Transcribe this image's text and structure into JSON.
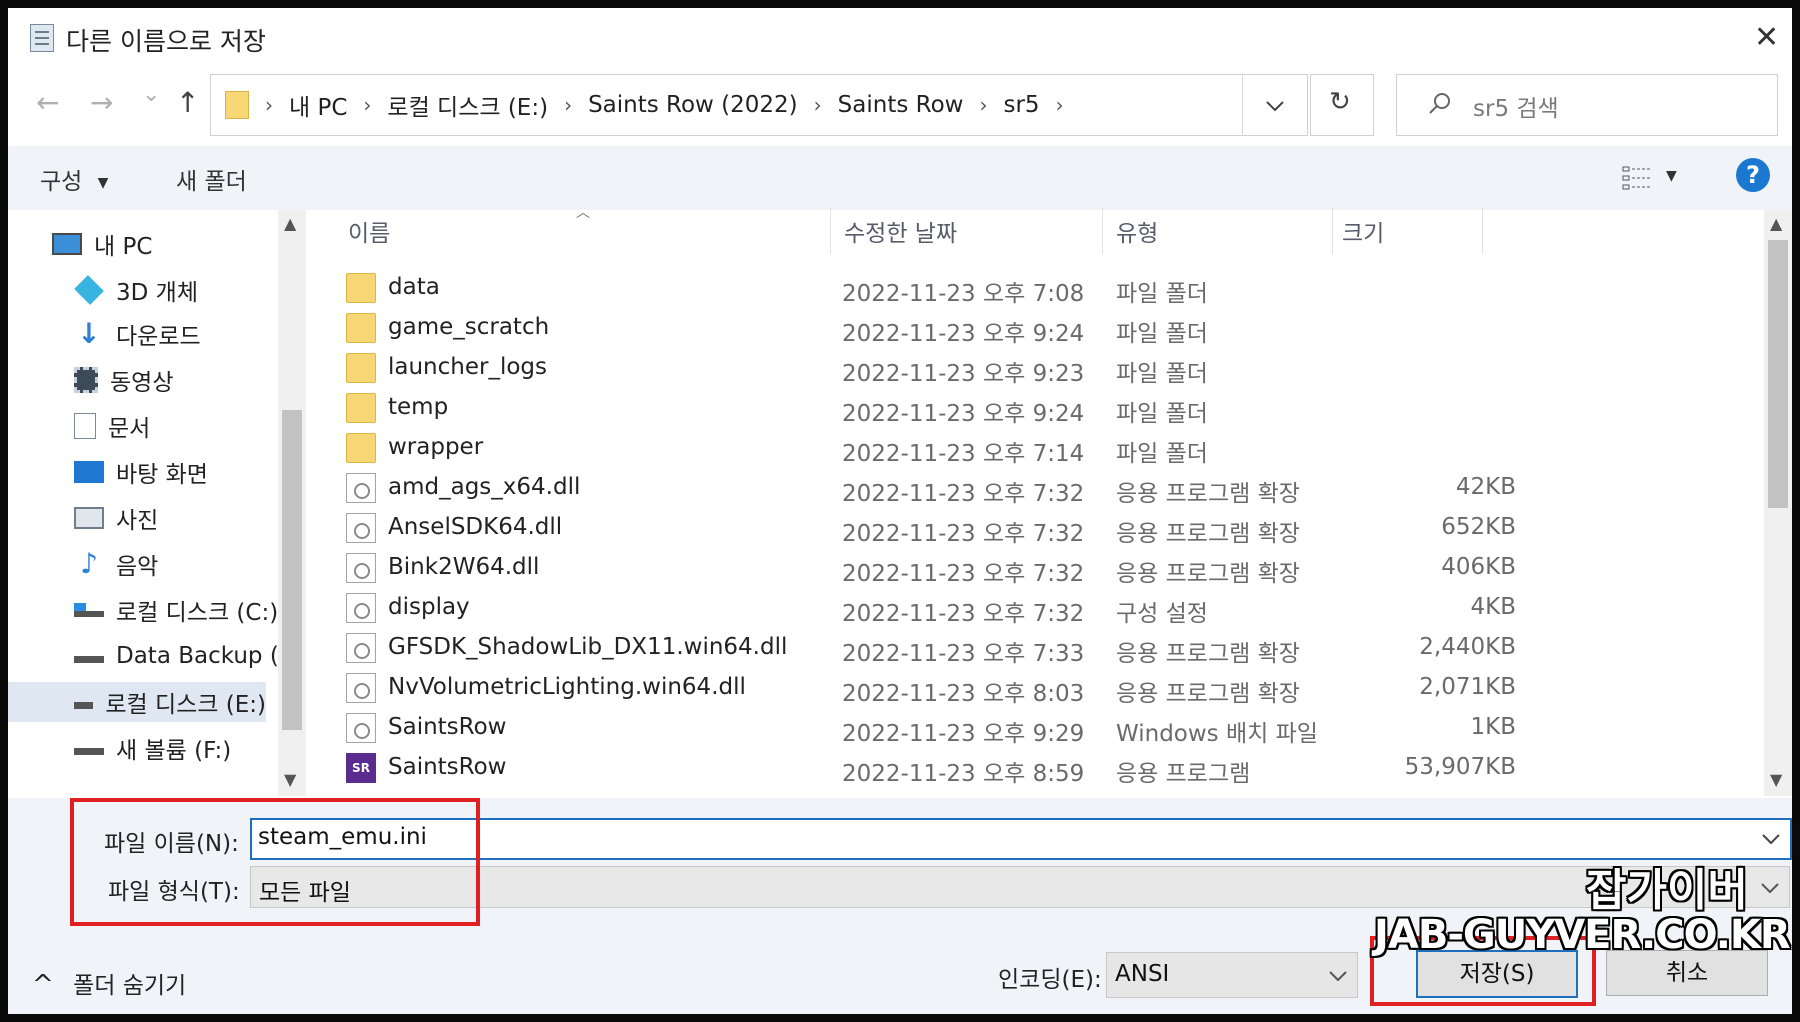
{
  "dialog": {
    "title": "다른 이름으로 저장",
    "close_glyph": "✕"
  },
  "nav": {
    "back_glyph": "←",
    "forward_glyph": "→",
    "recent_glyph": "⌄",
    "up_glyph": "↑",
    "breadcrumb": [
      "내 PC",
      "로컬 디스크 (E:)",
      "Saints Row (2022)",
      "Saints Row",
      "sr5"
    ],
    "breadcrumb_sep": "›",
    "refresh_glyph": "↻",
    "search_placeholder": "sr5 검색"
  },
  "toolbar": {
    "organize_label": "구성",
    "new_folder_label": "새 폴더",
    "help_glyph": "?"
  },
  "sidebar": {
    "items": [
      {
        "label": "내 PC",
        "icon": "pc-icon"
      },
      {
        "label": "3D 개체",
        "icon": "3d-objects-icon"
      },
      {
        "label": "다운로드",
        "icon": "download-icon"
      },
      {
        "label": "동영상",
        "icon": "video-icon"
      },
      {
        "label": "문서",
        "icon": "document-icon"
      },
      {
        "label": "바탕 화면",
        "icon": "desktop-icon"
      },
      {
        "label": "사진",
        "icon": "pictures-icon"
      },
      {
        "label": "음악",
        "icon": "music-icon"
      },
      {
        "label": "로컬 디스크 (C:)",
        "icon": "drive-icon"
      },
      {
        "label": "Data Backup (D",
        "icon": "drive-icon"
      },
      {
        "label": "로컬 디스크 (E:)",
        "icon": "drive-icon",
        "selected": true
      },
      {
        "label": "새 볼륨 (F:)",
        "icon": "drive-icon"
      }
    ]
  },
  "file_list": {
    "columns": [
      "이름",
      "수정한 날짜",
      "유형",
      "크기"
    ],
    "rows": [
      {
        "name": "data",
        "date": "2022-11-23 오후 7:08",
        "type": "파일 폴더",
        "size": "",
        "icon": "folder-icon"
      },
      {
        "name": "game_scratch",
        "date": "2022-11-23 오후 9:24",
        "type": "파일 폴더",
        "size": "",
        "icon": "folder-icon"
      },
      {
        "name": "launcher_logs",
        "date": "2022-11-23 오후 9:23",
        "type": "파일 폴더",
        "size": "",
        "icon": "folder-icon"
      },
      {
        "name": "temp",
        "date": "2022-11-23 오후 9:24",
        "type": "파일 폴더",
        "size": "",
        "icon": "folder-icon"
      },
      {
        "name": "wrapper",
        "date": "2022-11-23 오후 7:14",
        "type": "파일 폴더",
        "size": "",
        "icon": "folder-icon"
      },
      {
        "name": "amd_ags_x64.dll",
        "date": "2022-11-23 오후 7:32",
        "type": "응용 프로그램 확장",
        "size": "42KB",
        "icon": "dll-file-icon"
      },
      {
        "name": "AnselSDK64.dll",
        "date": "2022-11-23 오후 7:32",
        "type": "응용 프로그램 확장",
        "size": "652KB",
        "icon": "dll-file-icon"
      },
      {
        "name": "Bink2W64.dll",
        "date": "2022-11-23 오후 7:32",
        "type": "응용 프로그램 확장",
        "size": "406KB",
        "icon": "dll-file-icon"
      },
      {
        "name": "display",
        "date": "2022-11-23 오후 7:32",
        "type": "구성 설정",
        "size": "4KB",
        "icon": "config-file-icon"
      },
      {
        "name": "GFSDK_ShadowLib_DX11.win64.dll",
        "date": "2022-11-23 오후 7:33",
        "type": "응용 프로그램 확장",
        "size": "2,440KB",
        "icon": "dll-file-icon"
      },
      {
        "name": "NvVolumetricLighting.win64.dll",
        "date": "2022-11-23 오후 8:03",
        "type": "응용 프로그램 확장",
        "size": "2,071KB",
        "icon": "dll-file-icon"
      },
      {
        "name": "SaintsRow",
        "date": "2022-11-23 오후 9:29",
        "type": "Windows 배치 파일",
        "size": "1KB",
        "icon": "batch-file-icon"
      },
      {
        "name": "SaintsRow",
        "date": "2022-11-23 오후 8:59",
        "type": "응용 프로그램",
        "size": "53,907KB",
        "icon": "saintsrow-app-icon"
      }
    ],
    "exe_badge": "SR"
  },
  "save_panel": {
    "filename_label": "파일 이름(N):",
    "filename_value": "steam_emu.ini",
    "filetype_label": "파일 형식(T):",
    "filetype_value": "모든 파일",
    "hide_folders_label": "폴더 숨기기",
    "hide_folders_glyph": "^",
    "encoding_label": "인코딩(E):",
    "encoding_value": "ANSI",
    "save_label": "저장(S)",
    "cancel_label": "취소"
  },
  "watermark": {
    "line1": "잡가이버",
    "line2": "JAB-GUYVER.CO.KR"
  },
  "colors": {
    "highlight_red": "#e02020",
    "accent_blue": "#1f6fbf",
    "toolbar_bg": "#f0f4f9"
  }
}
